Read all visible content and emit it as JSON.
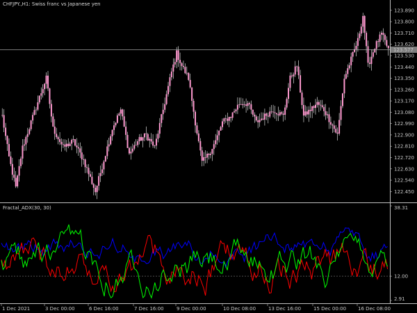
{
  "window": {
    "symbol_title": "CHFJPY.,H1:  Swiss franc vs Japanese yen",
    "indicator_title": "Fractal_ADX(30, 30)"
  },
  "colors": {
    "background": "#000000",
    "grid_line": "#c0c0c0",
    "candle_body": "#ff9ad0",
    "candle_wick": "#ffffff",
    "price_tag_bg": "#7d7d7d",
    "adx_plus": "#00ff00",
    "adx_minus": "#ff0000",
    "adx_main": "#0000ff",
    "level_dotted": "#808080"
  },
  "chart_data": [
    {
      "type": "candlestick",
      "title": "CHFJPY.,H1:  Swiss franc vs Japanese yen",
      "ylim": [
        122.38,
        123.95
      ],
      "yticks": [
        "123.890",
        "123.800",
        "123.710",
        "123.620",
        "123.530",
        "123.440",
        "123.350",
        "123.260",
        "123.170",
        "123.080",
        "122.990",
        "122.900",
        "122.810",
        "122.720",
        "122.630",
        "122.540",
        "122.450"
      ],
      "current_price": "123.577",
      "current_price_value": 123.577,
      "xticks": [
        "1 Dec 2021",
        "3 Dec 00:00",
        "6 Dec 16:00",
        "7 Dec 16:00",
        "9 Dec 00:00",
        "10 Dec 08:00",
        "13 Dec 16:00",
        "15 Dec 00:00",
        "16 Dec 08:00"
      ],
      "anchors": [
        [
          0,
          123.05
        ],
        [
          4,
          122.72
        ],
        [
          8,
          122.48
        ],
        [
          12,
          122.8
        ],
        [
          17,
          123.0
        ],
        [
          22,
          123.2
        ],
        [
          26,
          123.35
        ],
        [
          30,
          122.95
        ],
        [
          36,
          122.8
        ],
        [
          42,
          122.85
        ],
        [
          48,
          122.7
        ],
        [
          55,
          122.45
        ],
        [
          60,
          122.7
        ],
        [
          65,
          122.95
        ],
        [
          70,
          123.1
        ],
        [
          75,
          122.75
        ],
        [
          80,
          122.85
        ],
        [
          85,
          122.9
        ],
        [
          90,
          122.8
        ],
        [
          95,
          123.1
        ],
        [
          100,
          123.4
        ],
        [
          103,
          123.55
        ],
        [
          106,
          123.45
        ],
        [
          110,
          123.35
        ],
        [
          114,
          123.0
        ],
        [
          118,
          122.68
        ],
        [
          122,
          122.75
        ],
        [
          126,
          122.85
        ],
        [
          130,
          123.0
        ],
        [
          135,
          123.05
        ],
        [
          140,
          123.15
        ],
        [
          145,
          123.15
        ],
        [
          150,
          123.0
        ],
        [
          155,
          123.05
        ],
        [
          160,
          123.1
        ],
        [
          166,
          123.05
        ],
        [
          170,
          123.35
        ],
        [
          174,
          123.45
        ],
        [
          178,
          123.05
        ],
        [
          182,
          123.1
        ],
        [
          186,
          123.15
        ],
        [
          190,
          123.1
        ],
        [
          194,
          123.0
        ],
        [
          198,
          122.9
        ],
        [
          202,
          123.35
        ],
        [
          206,
          123.5
        ],
        [
          210,
          123.65
        ],
        [
          213,
          123.85
        ],
        [
          216,
          123.45
        ],
        [
          220,
          123.6
        ],
        [
          224,
          123.7
        ],
        [
          228,
          123.58
        ]
      ]
    },
    {
      "type": "line",
      "title": "Fractal_ADX(30, 30)",
      "ylim": [
        2.91,
        38.31
      ],
      "yticks": [
        "38.31",
        "12.00",
        "2.91"
      ],
      "level": 12.0,
      "series": [
        {
          "color": "#00ff00",
          "seed": 3,
          "base": 17,
          "amp": 9
        },
        {
          "color": "#ff0000",
          "seed": 7,
          "base": 16,
          "amp": 9
        },
        {
          "color": "#0000ff",
          "seed": 11,
          "base": 22,
          "amp": 6
        }
      ]
    }
  ]
}
